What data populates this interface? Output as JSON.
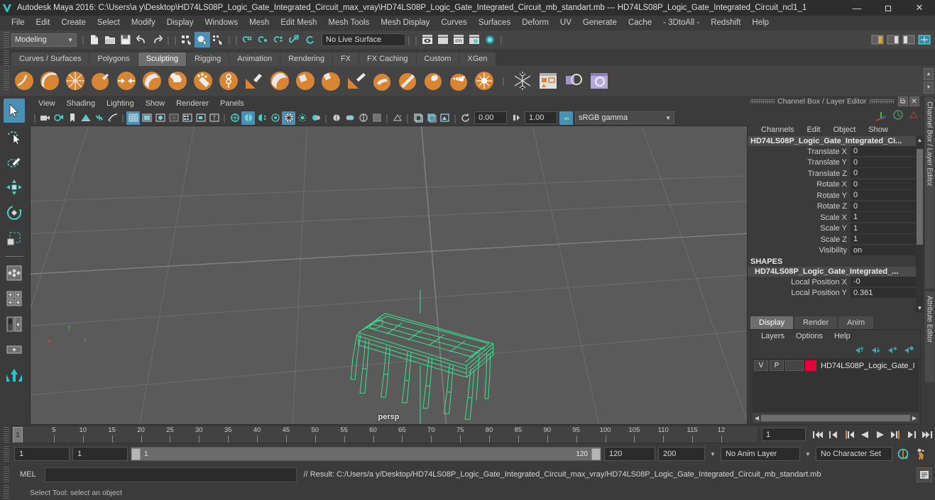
{
  "titlebar": {
    "app_icon": "maya-icon",
    "title": "Autodesk Maya 2016: C:\\Users\\a y\\Desktop\\HD74LS08P_Logic_Gate_Integrated_Circuit_max_vray\\HD74LS08P_Logic_Gate_Integrated_Circuit_mb_standart.mb  ---  HD74LS08P_Logic_Gate_Integrated_Circuit_ncl1_1",
    "minimize": "—",
    "maximize": "❐",
    "close": "✕"
  },
  "menubar": {
    "items": [
      "File",
      "Edit",
      "Create",
      "Select",
      "Modify",
      "Display",
      "Windows",
      "Mesh",
      "Edit Mesh",
      "Mesh Tools",
      "Mesh Display",
      "Curves",
      "Surfaces",
      "Deform",
      "UV",
      "Generate",
      "Cache",
      "- 3DtoAll -",
      "Redshift",
      "Help"
    ]
  },
  "statusbar": {
    "menuset": "Modeling",
    "live_surface": "No Live Surface",
    "icons": [
      "new-scene-icon",
      "open-scene-icon",
      "save-scene-icon",
      "undo-icon",
      "redo-icon",
      "select-by-hierarchy-icon",
      "select-by-object-icon",
      "select-by-component-icon",
      "snap-to-grid-icon",
      "snap-to-curve-icon",
      "snap-to-point-icon",
      "snap-to-projected-center-icon",
      "snap-to-view-plane-icon",
      "render-current-frame-icon",
      "ipr-render-icon",
      "render-settings-icon",
      "hypershade-icon"
    ]
  },
  "shelf": {
    "tabs": [
      "Curves / Surfaces",
      "Polygons",
      "Sculpting",
      "Rigging",
      "Animation",
      "Rendering",
      "FX",
      "FX Caching",
      "Custom",
      "XGen"
    ],
    "active_tab": "Sculpting",
    "icons": [
      "sculpt-tool-icon",
      "smooth-tool-icon",
      "relax-tool-icon",
      "grab-tool-icon",
      "pinch-tool-icon",
      "flatten-tool-icon",
      "foamy-tool-icon",
      "spray-tool-icon",
      "repeat-tool-icon",
      "imprint-tool-icon",
      "wax-tool-icon",
      "scrape-tool-icon",
      "fill-tool-icon",
      "knife-tool-icon",
      "smear-tool-icon",
      "bulge-tool-icon",
      "amplify-tool-icon",
      "freeze-tool-icon",
      "convert-tool-icon",
      "mirror-tool-icon",
      "snowflake-icon",
      "sculpt-layers-icon",
      "duplicate-layer-icon",
      "sculpt-layer-editor-icon"
    ]
  },
  "viewport": {
    "panel_menu": [
      "View",
      "Shading",
      "Lighting",
      "Show",
      "Renderer",
      "Panels"
    ],
    "tool_icons": [
      "camera-icon",
      "camera-attributes-icon",
      "bookmark-icon",
      "image-plane-icon",
      "two-sided-lighting-icon",
      "shadows-icon",
      "wireframe-icon",
      "smooth-shade-all-icon",
      "flat-shade-icon",
      "shaded-icon",
      "textured-icon",
      "use-default-material-icon",
      "xray-icon",
      "lights-icon",
      "shadow-map-icon",
      "ambient-occlusion-icon",
      "motion-blur-icon",
      "multisample-icon",
      "depth-of-field-icon",
      "isolate-select-icon",
      "grid-icon",
      "film-gate-icon",
      "resolution-gate-icon",
      "gate-mask-icon",
      "exposure-icon",
      "gamma-icon",
      "color-management-icon"
    ],
    "exposure_value": "0.00",
    "gamma_value": "1.00",
    "color_space": "sRGB gamma",
    "camera_label": "persp",
    "object_color": "#38e08f",
    "grid_color": "#6d6d6d",
    "background_color": "#5a5a5a",
    "axis_labels": [
      "x",
      "y",
      "z"
    ]
  },
  "channelbox": {
    "panel_title": "Channel Box / Layer Editor",
    "menu": [
      "Channels",
      "Edit",
      "Object",
      "Show"
    ],
    "object_name": "HD74LS08P_Logic_Gate_Integrated_Ci...",
    "transform_attrs": [
      {
        "label": "Translate X",
        "value": "0"
      },
      {
        "label": "Translate Y",
        "value": "0"
      },
      {
        "label": "Translate Z",
        "value": "0"
      },
      {
        "label": "Rotate X",
        "value": "0"
      },
      {
        "label": "Rotate Y",
        "value": "0"
      },
      {
        "label": "Rotate Z",
        "value": "0"
      },
      {
        "label": "Scale X",
        "value": "1"
      },
      {
        "label": "Scale Y",
        "value": "1"
      },
      {
        "label": "Scale Z",
        "value": "1"
      },
      {
        "label": "Visibility",
        "value": "on"
      }
    ],
    "shapes_header": "SHAPES",
    "shape_name": "HD74LS08P_Logic_Gate_Integrated_...",
    "shape_attrs": [
      {
        "label": "Local Position X",
        "value": "-0"
      },
      {
        "label": "Local Position Y",
        "value": "0.361"
      }
    ]
  },
  "layer_editor": {
    "tabs": [
      "Display",
      "Render",
      "Anim"
    ],
    "active_tab": "Display",
    "menu": [
      "Layers",
      "Options",
      "Help"
    ],
    "toolbar_icons": [
      "layer-move-up-icon",
      "layer-move-down-icon",
      "create-new-layer-icon",
      "create-layer-from-selected-icon"
    ],
    "layers": [
      {
        "visibility": "V",
        "playback": "P",
        "state": "",
        "color": "#e8003c",
        "name": "HD74LS08P_Logic_Gate_I"
      }
    ]
  },
  "right_tabs": [
    "Channel Box / Layer Editor",
    "Attribute Editor"
  ],
  "timeline": {
    "current_frame": "1",
    "start": 1,
    "end": 120,
    "tick_labels": [
      "5",
      "10",
      "15",
      "20",
      "25",
      "30",
      "35",
      "40",
      "45",
      "50",
      "55",
      "60",
      "65",
      "70",
      "75",
      "80",
      "85",
      "90",
      "95",
      "100",
      "105",
      "110",
      "115",
      "12"
    ],
    "frame_field": "1",
    "playback_buttons": [
      "go-to-start-icon",
      "step-back-keyframe-icon",
      "step-back-frame-icon",
      "play-backwards-icon",
      "play-forwards-icon",
      "step-forward-frame-icon",
      "step-forward-keyframe-icon",
      "go-to-end-icon"
    ]
  },
  "rangeslider": {
    "anim_start": "1",
    "range_start": "1",
    "slider_start_label": "1",
    "slider_end_label": "120",
    "range_end": "120",
    "anim_end": "200",
    "anim_layer": "No Anim Layer",
    "character_set": "No Character Set",
    "auto_key_icon": "auto-keyframe-icon",
    "anim_prefs_icon": "animation-preferences-icon"
  },
  "command_line": {
    "label": "MEL",
    "input_value": "",
    "result": "// Result: C:/Users/a y/Desktop/HD74LS08P_Logic_Gate_Integrated_Circuit_max_vray/HD74LS08P_Logic_Gate_Integrated_Circuit_mb_standart.mb",
    "script_editor_icon": "script-editor-icon"
  },
  "help_line": {
    "text": "Select Tool: select an object"
  },
  "toolbox": {
    "tools": [
      "select-tool",
      "lasso-select-tool",
      "paint-select-tool",
      "move-tool",
      "rotate-tool",
      "scale-tool"
    ],
    "layouts": [
      "single-perspective-layout",
      "four-view-layout",
      "two-pane-stacked-layout",
      "outliner-persp-layout",
      "hypergraph-persp-layout"
    ],
    "active_tool": "select-tool"
  }
}
